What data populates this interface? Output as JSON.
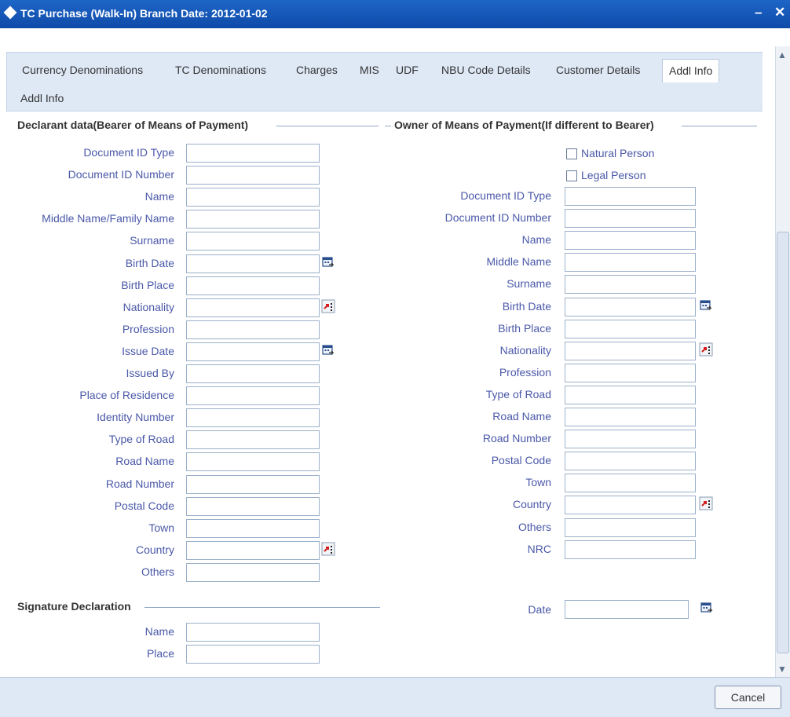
{
  "window": {
    "title": "TC Purchase (Walk-In)  Branch Date: 2012-01-02",
    "minimize_glyph": "–",
    "close_glyph": "✕"
  },
  "tabs": [
    {
      "label": "Currency Denominations"
    },
    {
      "label": "TC Denominations"
    },
    {
      "label": "Charges"
    },
    {
      "label": "MIS"
    },
    {
      "label": "UDF"
    },
    {
      "label": "NBU Code Details"
    },
    {
      "label": "Customer Details"
    },
    {
      "label": "Addl Info"
    }
  ],
  "active_tab": "Addl Info",
  "sub_tab": "Addl Info",
  "declarant": {
    "heading": "Declarant data(Bearer of Means of Payment)",
    "fields": [
      {
        "label": "Document ID Type",
        "value": ""
      },
      {
        "label": "Document ID Number",
        "value": ""
      },
      {
        "label": "Name",
        "value": ""
      },
      {
        "label": "Middle Name/Family Name",
        "value": ""
      },
      {
        "label": "Surname",
        "value": ""
      },
      {
        "label": "Birth Date",
        "value": "",
        "icon": "calendar-icon"
      },
      {
        "label": "Birth Place",
        "value": ""
      },
      {
        "label": "Nationality",
        "value": "",
        "icon": "lov-icon"
      },
      {
        "label": "Profession",
        "value": ""
      },
      {
        "label": "Issue Date",
        "value": "",
        "icon": "calendar-icon"
      },
      {
        "label": "Issued By",
        "value": ""
      },
      {
        "label": "Place of Residence",
        "value": ""
      },
      {
        "label": "Identity Number",
        "value": ""
      },
      {
        "label": "Type of Road",
        "value": ""
      },
      {
        "label": "Road Name",
        "value": ""
      },
      {
        "label": "Road Number",
        "value": ""
      },
      {
        "label": "Postal Code",
        "value": ""
      },
      {
        "label": "Town",
        "value": ""
      },
      {
        "label": "Country",
        "value": "",
        "icon": "lov-icon"
      },
      {
        "label": "Others",
        "value": ""
      }
    ]
  },
  "owner": {
    "heading": "Owner of Means of Payment(If different to Bearer)",
    "checkboxes": [
      {
        "label": "Natural Person",
        "checked": false
      },
      {
        "label": "Legal Person",
        "checked": false
      }
    ],
    "fields": [
      {
        "label": "Document ID Type",
        "value": ""
      },
      {
        "label": "Document ID Number",
        "value": ""
      },
      {
        "label": "Name",
        "value": ""
      },
      {
        "label": "Middle Name",
        "value": ""
      },
      {
        "label": "Surname",
        "value": ""
      },
      {
        "label": "Birth Date",
        "value": "",
        "icon": "calendar-icon"
      },
      {
        "label": "Birth Place",
        "value": ""
      },
      {
        "label": "Nationality",
        "value": "",
        "icon": "lov-icon"
      },
      {
        "label": "Profession",
        "value": ""
      },
      {
        "label": "Type of Road",
        "value": ""
      },
      {
        "label": "Road Name",
        "value": ""
      },
      {
        "label": "Road Number",
        "value": ""
      },
      {
        "label": "Postal Code",
        "value": ""
      },
      {
        "label": "Town",
        "value": ""
      },
      {
        "label": "Country",
        "value": "",
        "icon": "lov-icon"
      },
      {
        "label": "Others",
        "value": ""
      },
      {
        "label": "NRC",
        "value": ""
      }
    ]
  },
  "signature": {
    "heading": "Signature Declaration",
    "fields": [
      {
        "label": "Name",
        "value": ""
      },
      {
        "label": "Place",
        "value": ""
      }
    ],
    "date": {
      "label": "Date",
      "value": "",
      "icon": "calendar-icon"
    }
  },
  "footer": {
    "cancel_label": "Cancel"
  },
  "colors": {
    "titlebar": "#1a5fc4",
    "tab_bar": "#dfe9f6",
    "label_text": "#4a58a8",
    "field_border": "#9bb0c9"
  }
}
